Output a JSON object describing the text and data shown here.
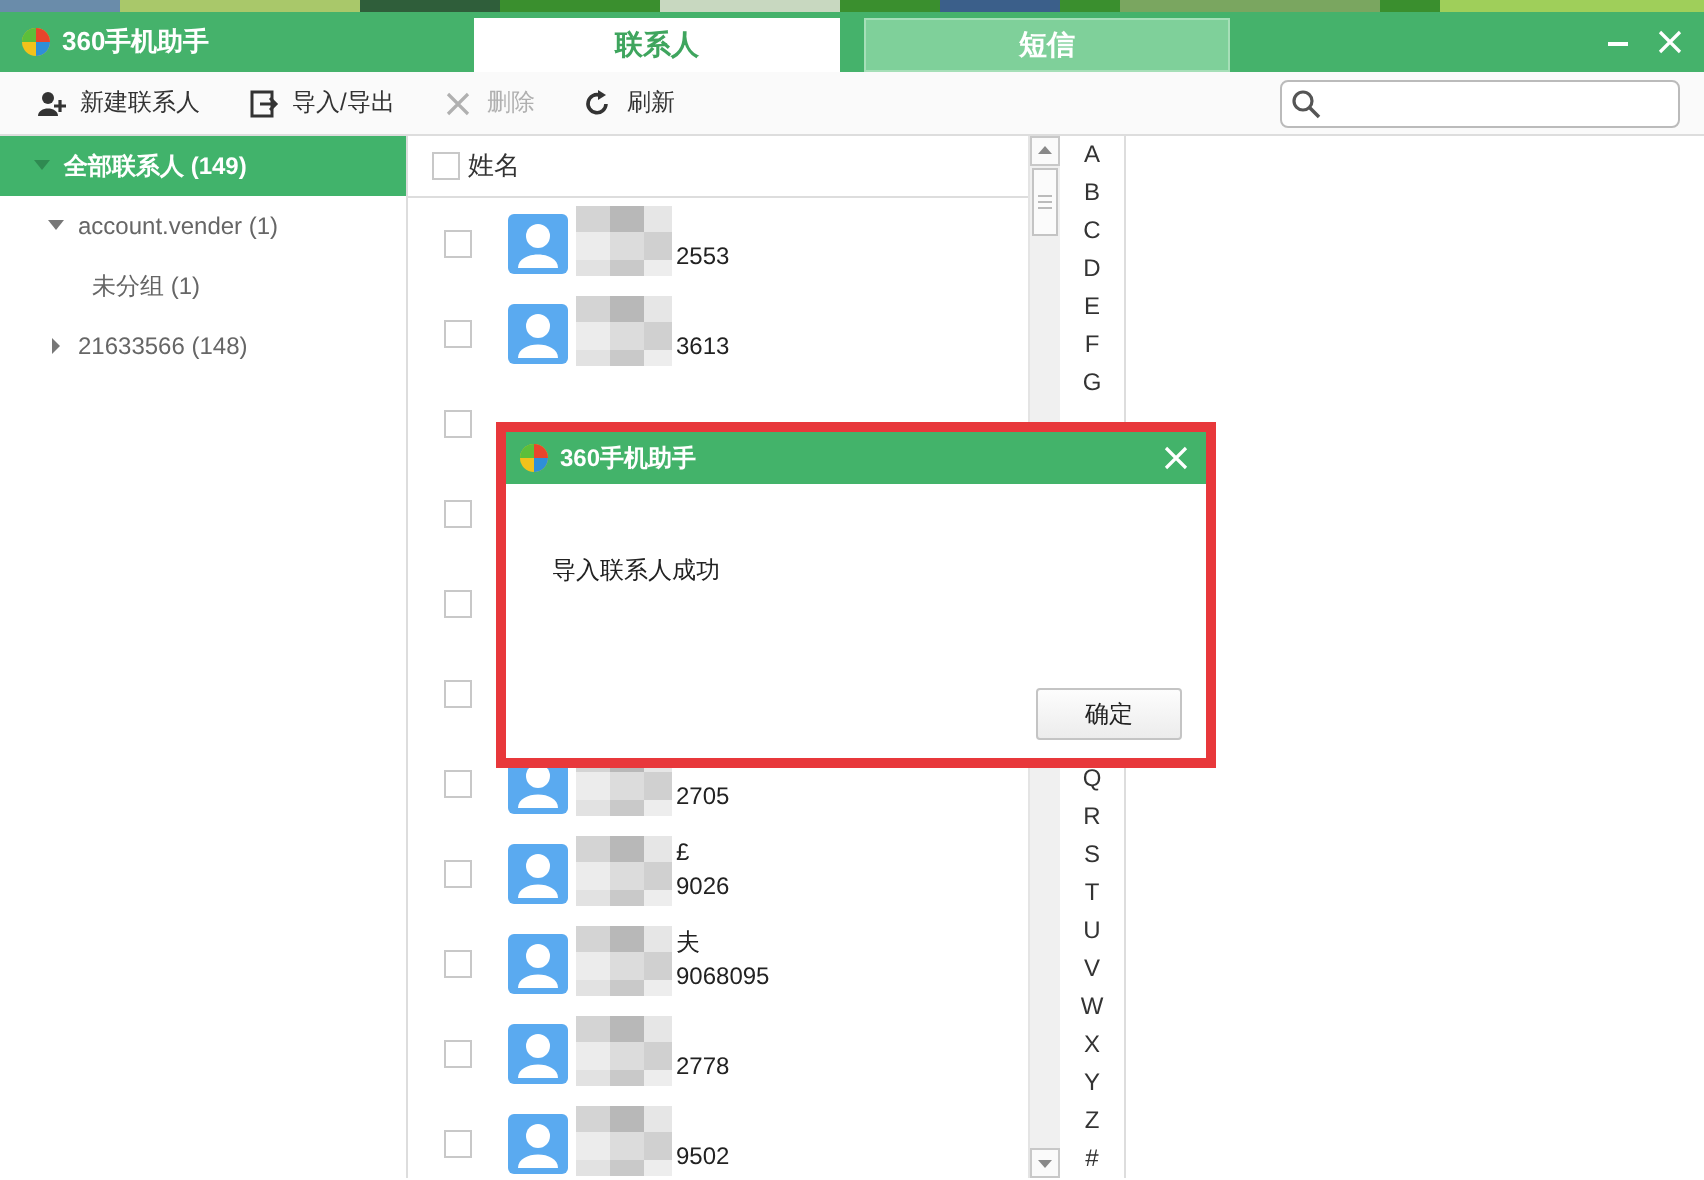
{
  "window": {
    "title": "360手机助手"
  },
  "tabs": [
    {
      "label": "联系人",
      "selected": true
    },
    {
      "label": "短信",
      "selected": false
    }
  ],
  "toolbar": [
    {
      "label": "新建联系人",
      "kind": "add",
      "disabled": false
    },
    {
      "label": "导入/导出",
      "kind": "transfer",
      "disabled": false
    },
    {
      "label": "删除",
      "kind": "delete",
      "disabled": true
    },
    {
      "label": "刷新",
      "kind": "refresh",
      "disabled": false
    }
  ],
  "sidebar": {
    "items": [
      {
        "label": "全部联系人 (149)",
        "selected": true,
        "expanded": true,
        "children": [
          {
            "label": "account.vender (1)",
            "selected": false,
            "expanded": true,
            "children": [
              {
                "label": "未分组 (1)",
                "selected": false
              }
            ]
          },
          {
            "label": "21633566 (148)",
            "selected": false,
            "expanded": false
          }
        ]
      }
    ]
  },
  "contacts": {
    "header": {
      "label": "姓名",
      "checked": false
    },
    "rows": [
      {
        "kind": "contact",
        "checked": false,
        "phone": "2553"
      },
      {
        "kind": "contact",
        "checked": false,
        "phone": "3613"
      },
      {
        "kind": "covered",
        "checked": false
      },
      {
        "kind": "covered",
        "checked": false
      },
      {
        "kind": "covered",
        "checked": false
      },
      {
        "kind": "covered",
        "checked": false
      },
      {
        "kind": "contact",
        "checked": false,
        "phone": "2705"
      },
      {
        "kind": "contact",
        "checked": false,
        "name": "£",
        "phone": "9026"
      },
      {
        "kind": "contact",
        "checked": false,
        "name": "夫",
        "phone": "9068095"
      },
      {
        "kind": "contact",
        "checked": false,
        "phone": "2778"
      },
      {
        "kind": "contact",
        "checked": false,
        "phone": "9502"
      }
    ]
  },
  "alphabet": {
    "top": [
      "A",
      "B",
      "C",
      "D",
      "E",
      "F",
      "G"
    ],
    "bottom": [
      "Q",
      "R",
      "S",
      "T",
      "U",
      "V",
      "W",
      "X",
      "Y",
      "Z",
      "#"
    ]
  },
  "dialog": {
    "title": "360手机助手",
    "message": "导入联系人成功",
    "buttons": [
      "确定"
    ]
  }
}
